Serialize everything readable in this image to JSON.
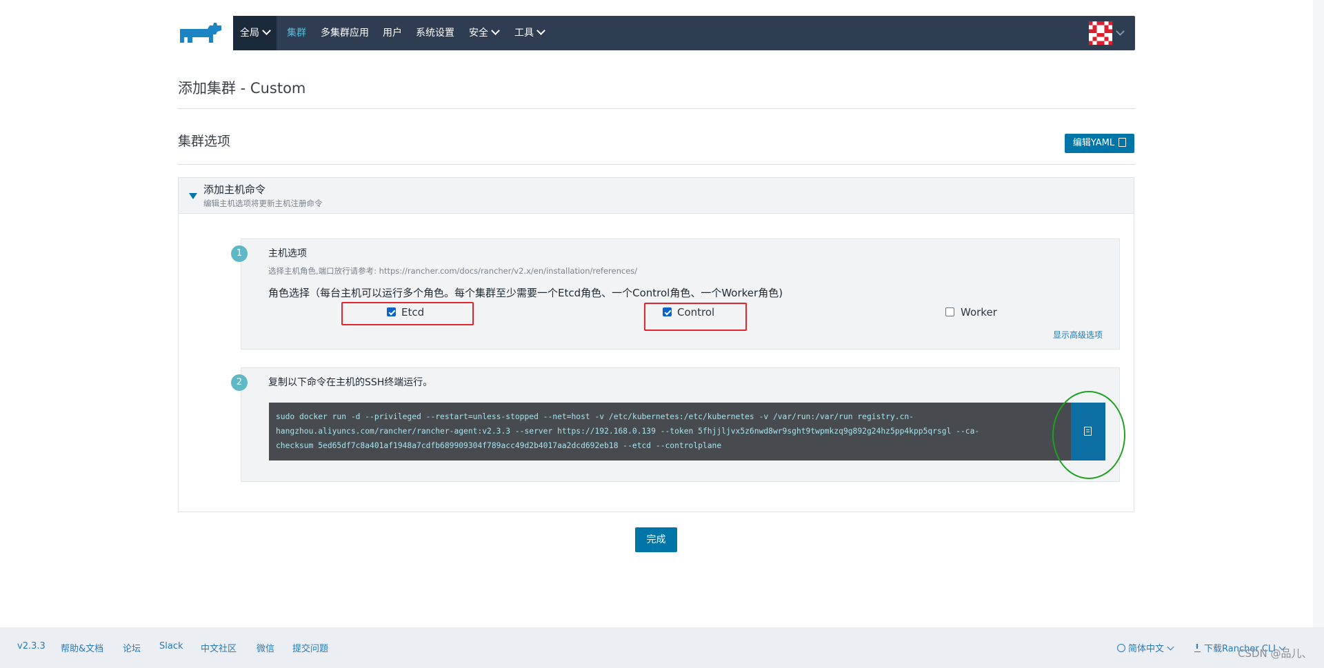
{
  "nav": {
    "items": [
      {
        "label": "全局"
      },
      {
        "label": "集群"
      },
      {
        "label": "多集群应用"
      },
      {
        "label": "用户"
      },
      {
        "label": "系统设置"
      },
      {
        "label": "安全"
      },
      {
        "label": "工具"
      }
    ],
    "logo_icon": "rancher-cow-logo-icon",
    "avatar_icon": "pixel-avatar-icon"
  },
  "page": {
    "title": "添加集群 - Custom"
  },
  "cluster_options": {
    "title": "集群选项",
    "edit_yaml_label": "编辑YAML"
  },
  "accordion": {
    "title": "添加主机命令",
    "subtitle": "编辑主机选项将更新主机注册命令"
  },
  "step1": {
    "number": "1",
    "title": "主机选项",
    "hint": "选择主机角色,端口放行请参考: https://rancher.com/docs/rancher/v2.x/en/installation/references/",
    "roles_label": "角色选择（每台主机可以运行多个角色。每个集群至少需要一个Etcd角色、一个Control角色、一个Worker角色)",
    "roles": [
      {
        "label": "Etcd",
        "checked": true
      },
      {
        "label": "Control",
        "checked": true
      },
      {
        "label": "Worker",
        "checked": false
      }
    ],
    "advanced_link": "显示高级选项"
  },
  "step2": {
    "number": "2",
    "title": "复制以下命令在主机的SSH终端运行。",
    "command_lines": [
      "sudo docker run -d --privileged --restart=unless-stopped --net=host -v /etc/kubernetes:/etc/kubernetes -v /var/run:/var/run registry.cn-",
      "hangzhou.aliyuncs.com/rancher/rancher-agent:v2.3.3 --server https://192.168.0.139 --token 5fhjjljvx5z6nwd8wr9sght9twpmkzq9g892g24hz5pp4kpp5qrsgl --ca-",
      "checksum 5ed65df7c8a401af1948a7cdfb689909304f789acc49d2b4017aa2dcd692eb18 --etcd --controlplane"
    ],
    "copy_icon": "clipboard-icon"
  },
  "done_label": "完成",
  "footer": {
    "links": [
      "v2.3.3",
      "帮助&文档",
      "论坛",
      "Slack",
      "中文社区",
      "微信",
      "提交问题"
    ],
    "language": "简体中文",
    "download_cli": "下载Rancher CLI"
  },
  "watermark": "CSDN @品儿、",
  "colors": {
    "nav_bg": "#2e3d51",
    "primary": "#0075a8",
    "annotation_red": "#e5232b",
    "annotation_green": "#1ea11e"
  }
}
